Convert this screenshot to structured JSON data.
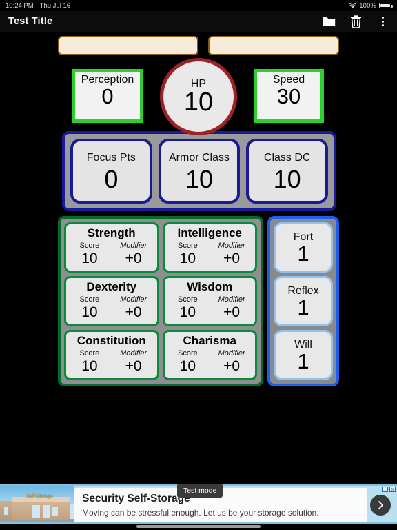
{
  "status_bar": {
    "time": "10:24 PM",
    "date": "Thu Jul 16",
    "battery_percent": "100%",
    "wifi_icon": "wifi-icon",
    "battery_icon": "battery-icon"
  },
  "app_bar": {
    "title": "Test Title",
    "actions": [
      {
        "name": "folder-icon",
        "label": "Open"
      },
      {
        "name": "trash-icon",
        "label": "Delete"
      },
      {
        "name": "overflow-menu-icon",
        "label": "More options"
      }
    ]
  },
  "name_fields": [
    {
      "name": "character-name-field",
      "value": "",
      "placeholder": ""
    },
    {
      "name": "character-class-field",
      "value": "",
      "placeholder": ""
    }
  ],
  "top_stats": {
    "perception": {
      "label": "Perception",
      "value": "0",
      "border_color": "#2bd02b"
    },
    "hp": {
      "label": "HP",
      "value": "10",
      "border_color": "#9b2328"
    },
    "speed": {
      "label": "Speed",
      "value": "30",
      "border_color": "#2bd02b"
    }
  },
  "defense": {
    "border_color": "#19199c",
    "items": [
      {
        "label": "Focus Pts",
        "value": "0"
      },
      {
        "label": "Armor Class",
        "value": "10"
      },
      {
        "label": "Class DC",
        "value": "10"
      }
    ]
  },
  "abilities": {
    "border_color": "#046a2e",
    "score_header": "Score",
    "modifier_header": "Modifier",
    "rows": [
      [
        {
          "name": "Strength",
          "score": "10",
          "modifier": "+0"
        },
        {
          "name": "Intelligence",
          "score": "10",
          "modifier": "+0"
        }
      ],
      [
        {
          "name": "Dexterity",
          "score": "10",
          "modifier": "+0"
        },
        {
          "name": "Wisdom",
          "score": "10",
          "modifier": "+0"
        }
      ],
      [
        {
          "name": "Constitution",
          "score": "10",
          "modifier": "+0"
        },
        {
          "name": "Charisma",
          "score": "10",
          "modifier": "+0"
        }
      ]
    ]
  },
  "saves": {
    "border_color": "#1f5ff0",
    "items": [
      {
        "label": "Fort",
        "value": "1"
      },
      {
        "label": "Reflex",
        "value": "1"
      },
      {
        "label": "Will",
        "value": "1"
      }
    ]
  },
  "ad": {
    "title": "Security Self-Storage",
    "subtitle": "Moving can be stressful enough. Let us be your storage solution.",
    "image_sign_text": "Self-Storage",
    "cta_icon": "chevron-right-icon",
    "adchoices_label": "AdChoices",
    "test_mode_label": "Test mode"
  }
}
